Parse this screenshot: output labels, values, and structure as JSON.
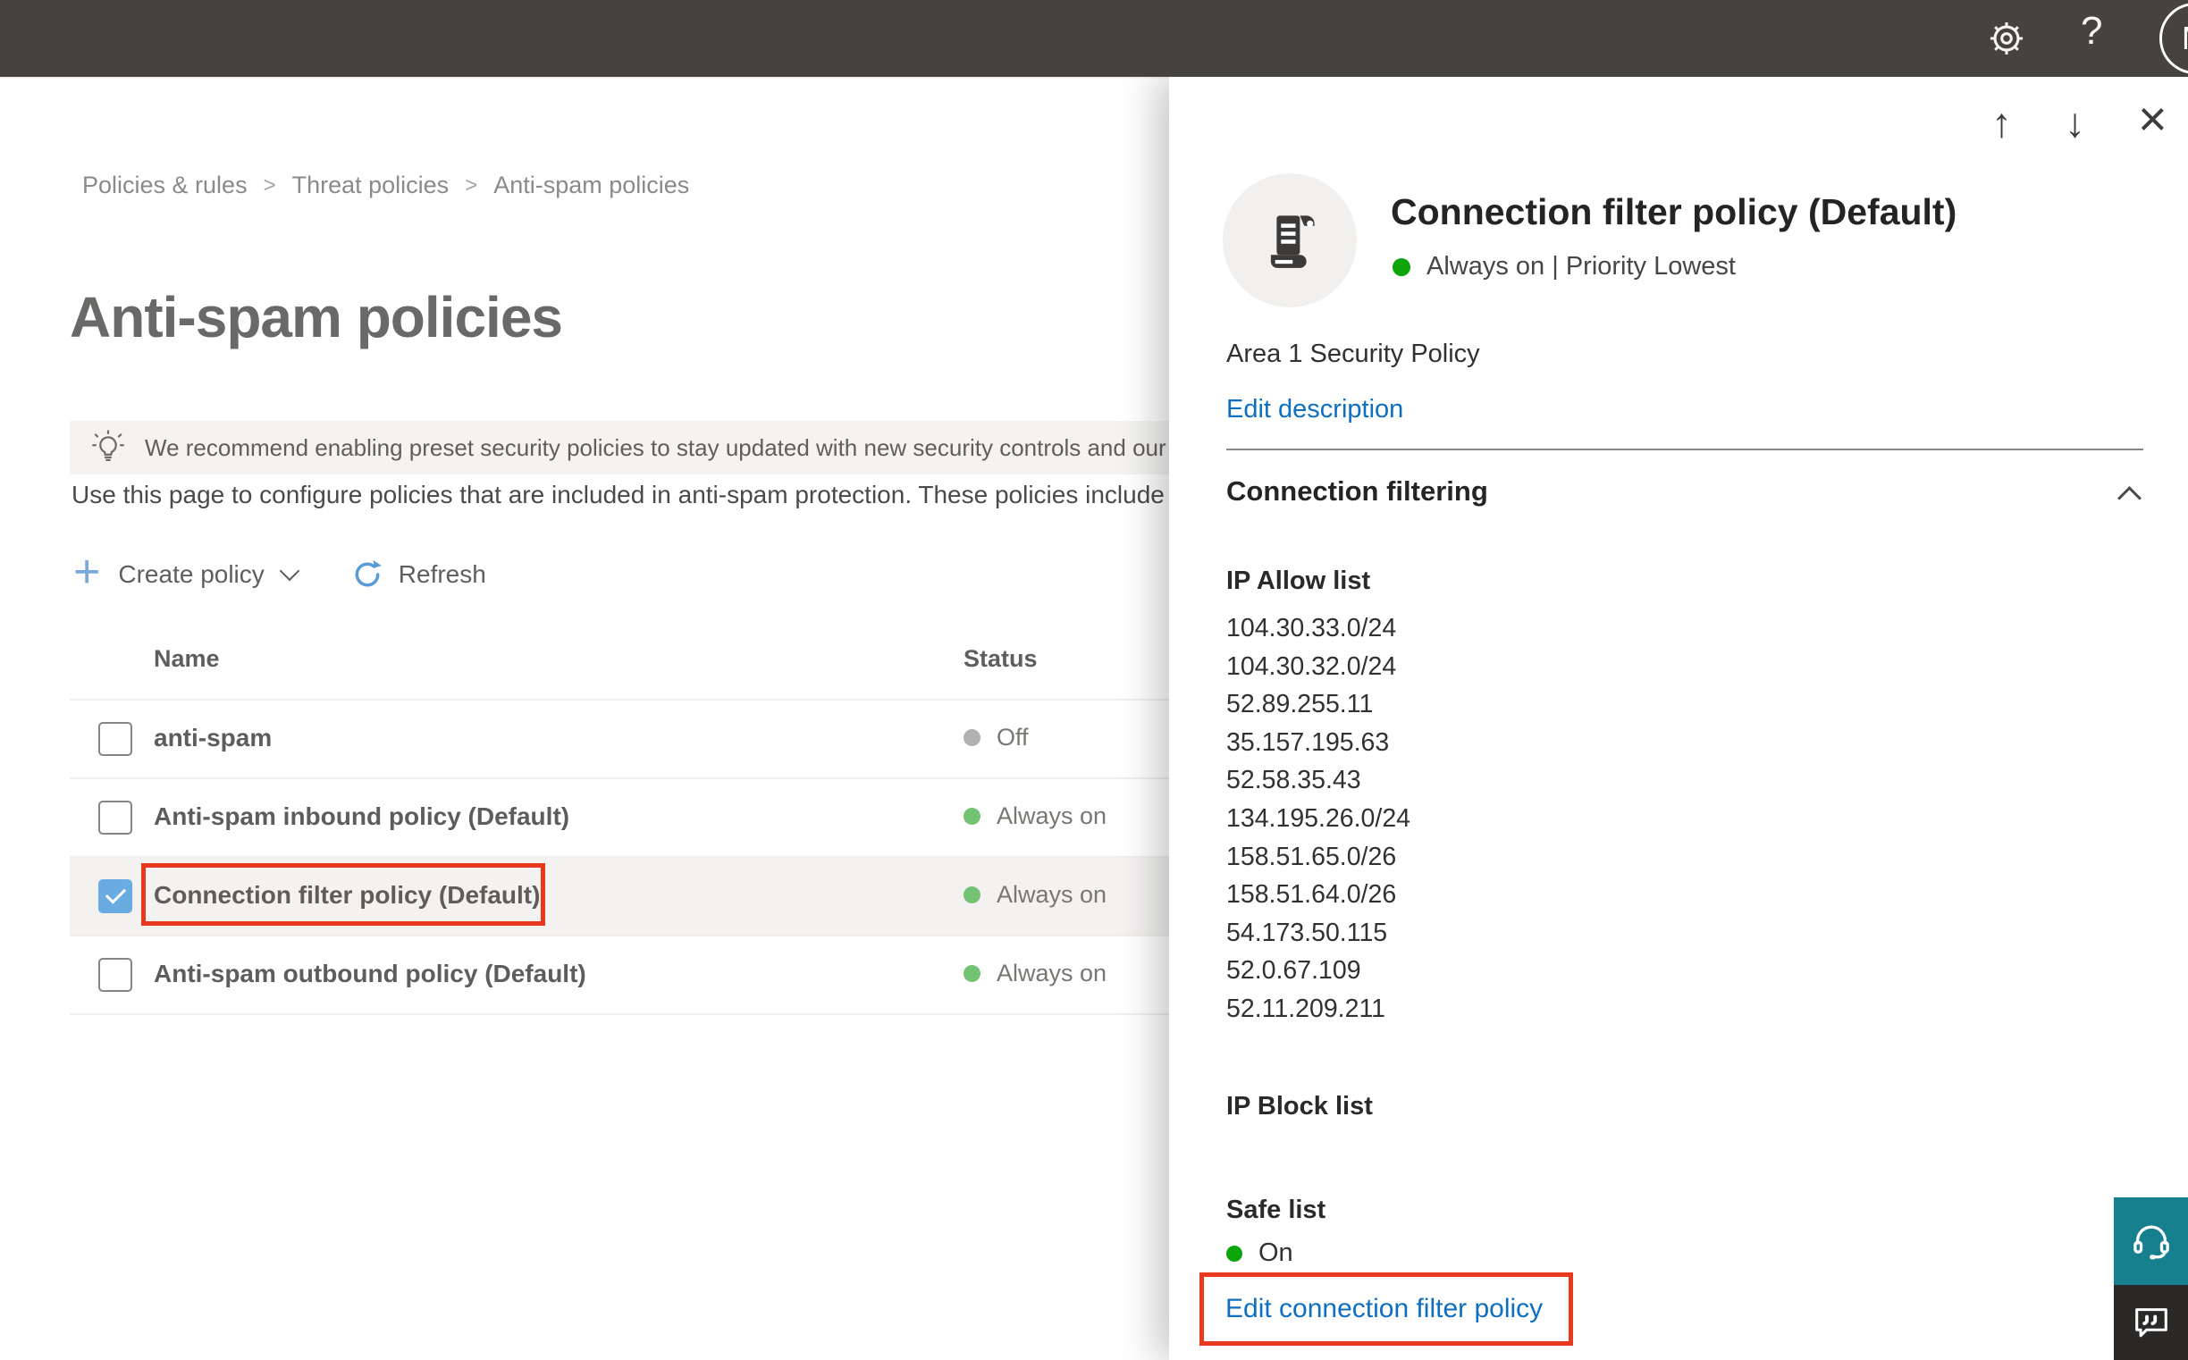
{
  "topbar": {
    "avatar_initial": "M"
  },
  "breadcrumb": {
    "separator": ">",
    "items": [
      "Policies & rules",
      "Threat policies",
      "Anti-spam policies"
    ]
  },
  "page": {
    "title": "Anti-spam policies",
    "banner_text": "We recommend enabling preset security policies to stay updated with new security controls and our recommendations",
    "description": "Use this page to configure policies that are included in anti-spam protection. These policies include"
  },
  "toolbar": {
    "create_label": "Create policy",
    "refresh_label": "Refresh"
  },
  "table": {
    "columns": [
      "Name",
      "Status"
    ],
    "rows": [
      {
        "name": "anti-spam",
        "status": "Off",
        "state": "off",
        "checked": false
      },
      {
        "name": "Anti-spam inbound policy (Default)",
        "status": "Always on",
        "state": "on",
        "checked": false
      },
      {
        "name": "Connection filter policy (Default)",
        "status": "Always on",
        "state": "on",
        "checked": true,
        "highlighted": true
      },
      {
        "name": "Anti-spam outbound policy (Default)",
        "status": "Always on",
        "state": "on",
        "checked": false
      }
    ]
  },
  "flyout": {
    "title": "Connection filter policy (Default)",
    "status_line": "Always on | Priority Lowest",
    "policy_description": "Area 1 Security Policy",
    "edit_description_label": "Edit description",
    "section_title": "Connection filtering",
    "ip_allow_label": "IP Allow list",
    "ip_allow": [
      "104.30.33.0/24",
      "104.30.32.0/24",
      "52.89.255.11",
      "35.157.195.63",
      "52.58.35.43",
      "134.195.26.0/24",
      "158.51.65.0/26",
      "158.51.64.0/26",
      "54.173.50.115",
      "52.0.67.109",
      "52.11.209.211"
    ],
    "ip_block_label": "IP Block list",
    "safe_list_label": "Safe list",
    "safe_list_status": "On",
    "edit_link_label": "Edit connection filter policy"
  },
  "colors": {
    "accent_blue": "#0e6fc0",
    "status_green_row": "#74c274",
    "status_green_vivid": "#0ca50c",
    "status_gray": "#b3b1af",
    "highlight_red": "#e8391f",
    "checkbox_blue": "#6aabe2",
    "topbar_bg": "#454240",
    "teal_button": "#16808e",
    "chat_button": "#2a2927"
  }
}
